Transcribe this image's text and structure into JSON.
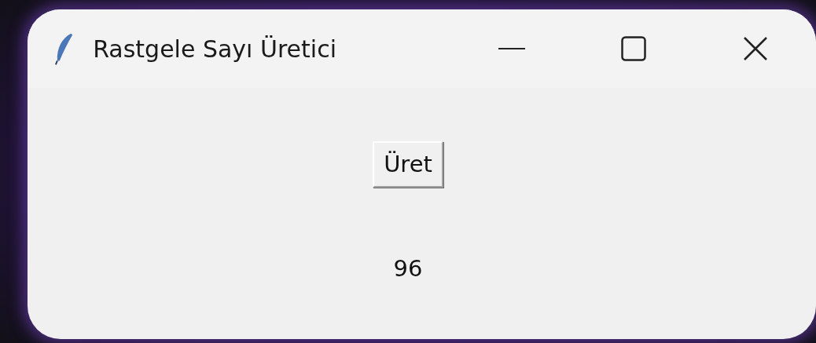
{
  "window": {
    "title": "Rastgele Sayı Üretici"
  },
  "generate_button": {
    "label": "Üret"
  },
  "result": {
    "text": "96"
  }
}
